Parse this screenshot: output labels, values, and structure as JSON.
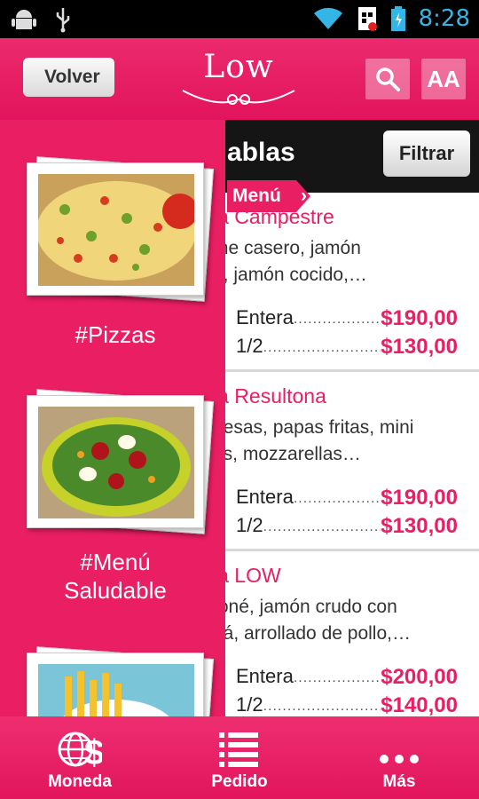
{
  "status_bar": {
    "time": "8:28"
  },
  "header": {
    "back_label": "Volver",
    "logo_text": "Low",
    "font_size_label": "AA"
  },
  "category": {
    "title": "ablas",
    "filter_label": "Filtrar",
    "menu_tag": "Menú"
  },
  "items": [
    {
      "name": "la Campestre",
      "desc_1": "me casero, jamón",
      "desc_2": "o, jamón cocido,…",
      "rows": [
        {
          "label": "Entera",
          "price": "$190,00"
        },
        {
          "label": "1/2",
          "price": "$130,00"
        }
      ]
    },
    {
      "name": "la Resultona",
      "desc_1": "nesas, papas fritas, mini",
      "desc_2": "as, mozzarellas…",
      "rows": [
        {
          "label": "Entera",
          "price": "$190,00"
        },
        {
          "label": "1/2",
          "price": "$130,00"
        }
      ]
    },
    {
      "name": "la LOW",
      "desc_1": "toné, jamón crudo con",
      "desc_2": "eá, arrollado de pollo,…",
      "rows": [
        {
          "label": "Entera",
          "price": "$200,00"
        },
        {
          "label": "1/2",
          "price": "$140,00"
        }
      ]
    }
  ],
  "drawer": [
    {
      "label_1": "#Pizzas",
      "label_2": ""
    },
    {
      "label_1": "#Menú",
      "label_2": "Saludable"
    }
  ],
  "bottom_nav": {
    "currency_label": "Moneda",
    "order_label": "Pedido",
    "more_label": "Más"
  },
  "colors": {
    "brand": "#e91e63",
    "accent": "#f5a020",
    "status_time": "#33b5e5"
  }
}
